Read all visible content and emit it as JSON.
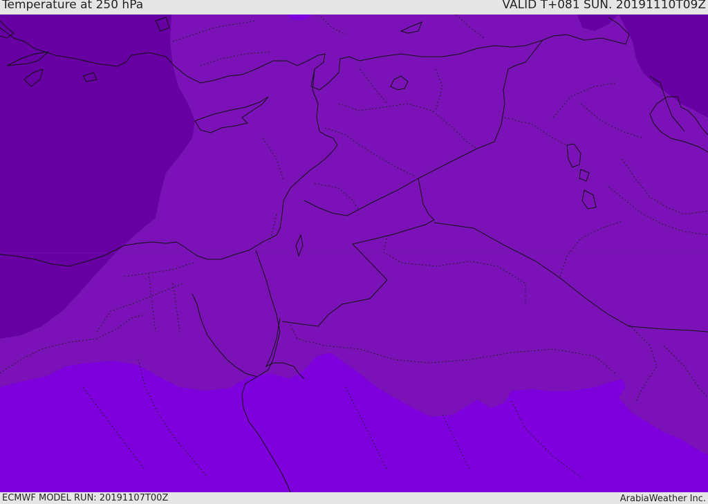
{
  "header": {
    "title": "Temperature at 250 hPa",
    "valid": "VALID T+081 SUN. 20191110T09Z"
  },
  "footer": {
    "model_run": "ECMWF MODEL RUN: 20191107T00Z",
    "credit": "ArabiaWeather Inc."
  },
  "map": {
    "colors": {
      "coldest": "#6700a3",
      "cold": "#7710b4",
      "mid": "#7b17b9",
      "warm": "#7e00dc",
      "border": "#111111",
      "admin_border": "#222222"
    }
  }
}
